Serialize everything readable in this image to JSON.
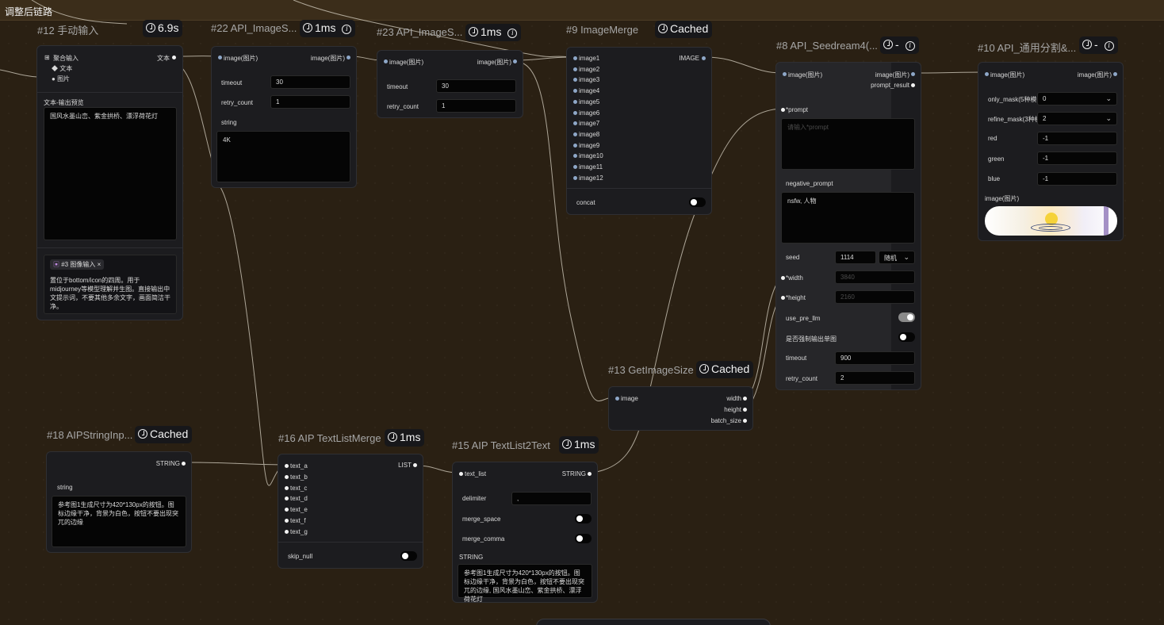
{
  "header": {
    "title": "调整后链路"
  },
  "nodes": {
    "n12": {
      "title": "#12 手动输入",
      "time": "6.9s",
      "mode_label": "聚合输入",
      "output_label": "文本",
      "options": [
        "文本",
        "图片"
      ],
      "preview_label": "文本-输出预览",
      "preview_text": "国风水墨山峦、紫金拱桥、漂浮荷花灯",
      "tag_label": "#3 图像输入",
      "note_text": "置位于bottom/icon的四周。用于midjourney等模型理解并生图。直接输出中文提示词，不要其他多余文字，画面简洁干净。"
    },
    "n22": {
      "title": "#22 API_ImageS...",
      "time": "1ms",
      "input_label": "image(图片)",
      "output_label": "image(图片)",
      "timeout_label": "timeout",
      "timeout_value": "30",
      "retry_label": "retry_count",
      "retry_value": "1",
      "string_label": "string",
      "string_value": "4K"
    },
    "n23": {
      "title": "#23 API_ImageS...",
      "time": "1ms",
      "input_label": "image(图片)",
      "output_label": "image(图片)",
      "timeout_label": "timeout",
      "timeout_value": "30",
      "retry_label": "retry_count",
      "retry_value": "1"
    },
    "n9": {
      "title": "#9 ImageMerge",
      "time": "Cached",
      "inputs": [
        "image1",
        "image2",
        "image3",
        "image4",
        "image5",
        "image6",
        "image7",
        "image8",
        "image9",
        "image10",
        "image11",
        "image12"
      ],
      "output_label": "IMAGE",
      "concat_label": "concat"
    },
    "n8": {
      "title": "#8 API_Seedream4(...",
      "time": "-",
      "input_label": "image(图片)",
      "out1": "image(图片)",
      "out2": "prompt_result",
      "prompt_label": "*prompt",
      "prompt_placeholder": "请输入*prompt",
      "neg_label": "negative_prompt",
      "neg_value": "nsfw, 人物",
      "seed_label": "seed",
      "seed_value": "1114",
      "seed_mode": "随机",
      "width_label": "*width",
      "width_value": "3840",
      "height_label": "*height",
      "height_value": "2160",
      "use_pre_llm_label": "use_pre_llm",
      "use_pre_llm_on": true,
      "force_single_label": "是否强制输出单图",
      "force_single_on": false,
      "timeout_label": "timeout",
      "timeout_value": "900",
      "retry_label": "retry_count",
      "retry_value": "2"
    },
    "n10": {
      "title": "#10 API_通用分割&...",
      "time": "-",
      "input_label": "image(图片)",
      "output_label": "image(图片)",
      "only_mask_label": "only_mask(5种模",
      "only_mask_value": "0",
      "refine_label": "refine_mask(3种模",
      "refine_value": "2",
      "red_label": "red",
      "red_value": "-1",
      "green_label": "green",
      "green_value": "-1",
      "blue_label": "blue",
      "blue_value": "-1",
      "image_label": "image(图片)"
    },
    "n13": {
      "title": "#13 GetImageSize",
      "time": "Cached",
      "input_label": "image",
      "outputs": [
        "width",
        "height",
        "batch_size"
      ]
    },
    "n18": {
      "title": "#18 AIPStringInp...",
      "time": "Cached",
      "output_label": "STRING",
      "string_label": "string",
      "string_value": "参考图1生成尺寸为420*130px的按钮。图标边缘干净，背景为白色，按钮不要出现突兀的边缘"
    },
    "n16": {
      "title": "#16 AIP TextListMerge",
      "time": "1ms",
      "inputs": [
        "text_a",
        "text_b",
        "text_c",
        "text_d",
        "text_e",
        "text_f",
        "text_g"
      ],
      "output_label": "LIST",
      "skip_label": "skip_null"
    },
    "n15": {
      "title": "#15 AIP TextList2Text",
      "time": "1ms",
      "input_label": "text_list",
      "output_label": "STRING",
      "delimiter_label": "delimiter",
      "delimiter_value": ",",
      "merge_space_label": "merge_space",
      "merge_comma_label": "merge_comma",
      "string_label": "STRING",
      "string_value": "参考图1生成尺寸为420*130px的按钮。图标边缘干净，背景为白色，按钮不要出现突兀的边缘, 国风水墨山峦、紫金拱桥、漂浮荷花灯"
    }
  }
}
